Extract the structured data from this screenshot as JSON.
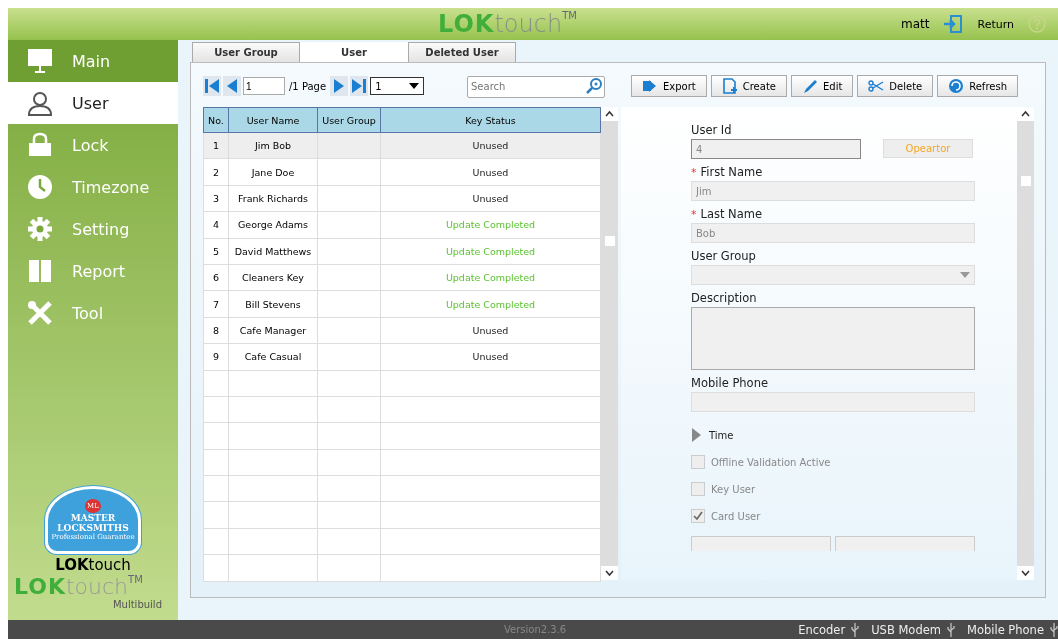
{
  "header": {
    "logo": {
      "lok": "LOK",
      "touch": "touch",
      "tm": "TM"
    },
    "user": "matt",
    "return_label": "Return"
  },
  "sidebar": {
    "items": [
      {
        "label": "Main",
        "selected": false,
        "hovered": true
      },
      {
        "label": "User",
        "selected": true,
        "hovered": false
      },
      {
        "label": "Lock",
        "selected": false,
        "hovered": false
      },
      {
        "label": "Timezone",
        "selected": false,
        "hovered": false
      },
      {
        "label": "Setting",
        "selected": false,
        "hovered": false
      },
      {
        "label": "Report",
        "selected": false,
        "hovered": false
      },
      {
        "label": "Tool",
        "selected": false,
        "hovered": false
      }
    ],
    "badge": {
      "top": "ML",
      "line1": "MASTER",
      "line2": "LOCKSMITHS",
      "line3": "Professional Guarantee"
    },
    "brand_small": {
      "lok": "LOK",
      "touch": "touch"
    },
    "brand_large": {
      "lok": "LOK",
      "touch": "touch",
      "tm": "TM",
      "sub": "Multibuild"
    }
  },
  "tabs": [
    {
      "label": "User Group",
      "selected": false
    },
    {
      "label": "User",
      "selected": true
    },
    {
      "label": "Deleted User",
      "selected": false
    }
  ],
  "pager": {
    "page": "1",
    "of_label": "/1 Page",
    "page_select": "1"
  },
  "search": {
    "placeholder": "Search"
  },
  "toolbar": [
    {
      "label": "Export"
    },
    {
      "label": "Create"
    },
    {
      "label": "Edit"
    },
    {
      "label": "Delete"
    },
    {
      "label": "Refresh"
    }
  ],
  "table": {
    "columns": [
      "No.",
      "User Name",
      "User Group",
      "Key Status"
    ],
    "rows": [
      {
        "no": "1",
        "name": "Jim Bob",
        "group": "",
        "status": "Unused",
        "kind": "unused",
        "selected": true
      },
      {
        "no": "2",
        "name": "Jane Doe",
        "group": "",
        "status": "Unused",
        "kind": "unused",
        "selected": false
      },
      {
        "no": "3",
        "name": "Frank Richards",
        "group": "",
        "status": "Unused",
        "kind": "unused",
        "selected": false
      },
      {
        "no": "4",
        "name": "George Adams",
        "group": "",
        "status": "Update Completed",
        "kind": "completed",
        "selected": false
      },
      {
        "no": "5",
        "name": "David Matthews",
        "group": "",
        "status": "Update Completed",
        "kind": "completed",
        "selected": false
      },
      {
        "no": "6",
        "name": "Cleaners Key",
        "group": "",
        "status": "Update Completed",
        "kind": "completed",
        "selected": false
      },
      {
        "no": "7",
        "name": "Bill Stevens",
        "group": "",
        "status": "Update Completed",
        "kind": "completed",
        "selected": false
      },
      {
        "no": "8",
        "name": "Cafe Manager",
        "group": "",
        "status": "Unused",
        "kind": "unused",
        "selected": false
      },
      {
        "no": "9",
        "name": "Cafe Casual",
        "group": "",
        "status": "Unused",
        "kind": "unused",
        "selected": false
      }
    ]
  },
  "form": {
    "user_id": {
      "label": "User Id",
      "value": "4"
    },
    "role_button": "Opeartor",
    "first_name": {
      "label": "First Name",
      "marker": "*",
      "value": "Jim"
    },
    "last_name": {
      "label": "Last Name",
      "marker": "*",
      "value": "Bob"
    },
    "user_group": {
      "label": "User Group"
    },
    "description": {
      "label": "Description"
    },
    "mobile_phone": {
      "label": "Mobile Phone"
    },
    "time": {
      "label": "Time",
      "expanded": false
    },
    "checkboxes": [
      {
        "label": "Offline Validation Active",
        "checked": false
      },
      {
        "label": "Key User",
        "checked": false
      },
      {
        "label": "Card User",
        "checked": true
      }
    ]
  },
  "status_bar": {
    "version": "Version2.3.6",
    "devices": [
      "Encoder",
      "USB Modem",
      "Mobile Phone"
    ]
  }
}
